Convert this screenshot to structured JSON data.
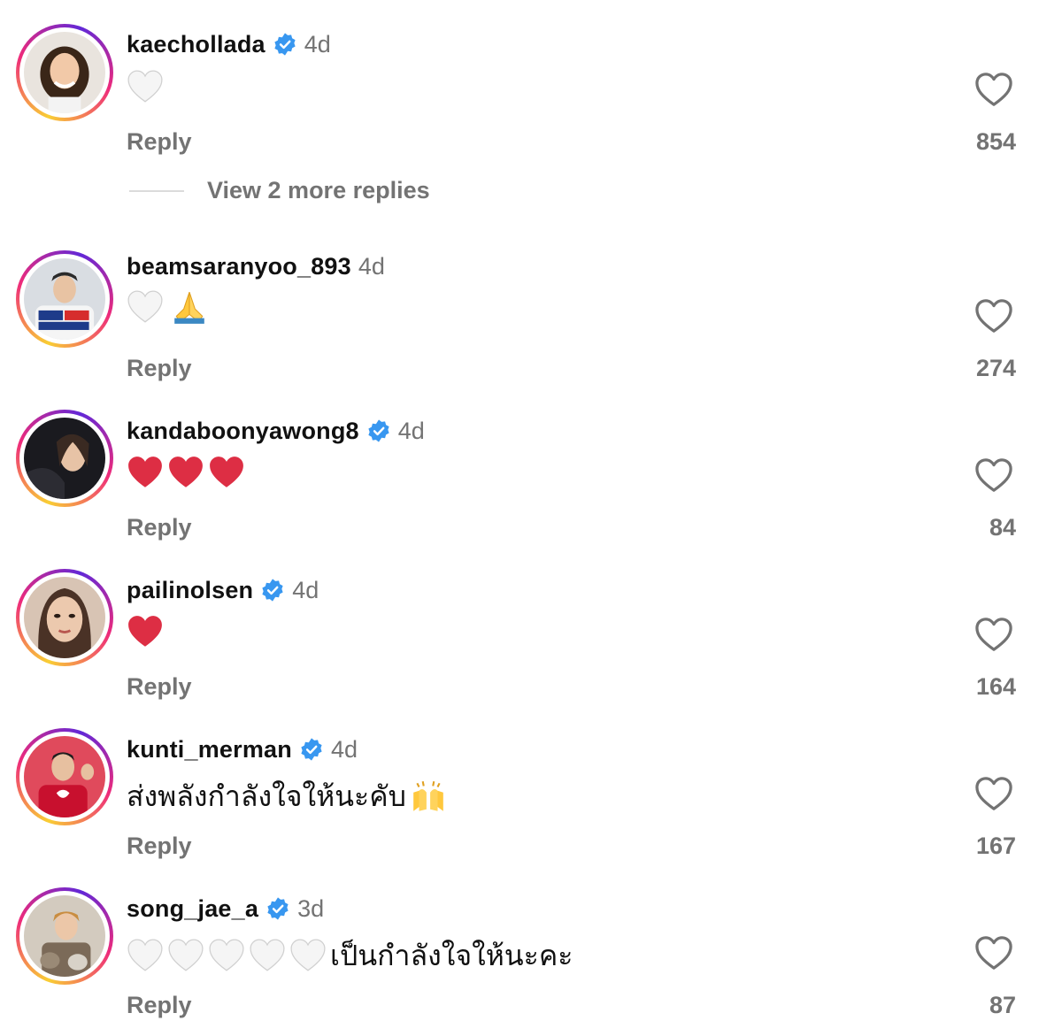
{
  "comments": [
    {
      "username": "kaechollada",
      "verified": true,
      "time": "4d",
      "emojis": [
        "white-heart"
      ],
      "text": "",
      "reply": "Reply",
      "likes": "854"
    },
    {
      "username": "beamsaranyoo_893",
      "verified": false,
      "time": "4d",
      "emojis": [
        "white-heart",
        "folded-hands"
      ],
      "text": "",
      "reply": "Reply",
      "likes": "274"
    },
    {
      "username": "kandaboonyawong8",
      "verified": true,
      "time": "4d",
      "emojis": [
        "red-heart",
        "red-heart",
        "red-heart"
      ],
      "text": "",
      "reply": "Reply",
      "likes": "84"
    },
    {
      "username": "pailinolsen",
      "verified": true,
      "time": "4d",
      "emojis": [
        "red-heart"
      ],
      "text": "",
      "reply": "Reply",
      "likes": "164"
    },
    {
      "username": "kunti_merman",
      "verified": true,
      "time": "4d",
      "emojis": [],
      "text": "ส่งพลังกำลังใจให้นะคับ",
      "reply": "Reply",
      "likes": "167"
    },
    {
      "username": "song_jae_a",
      "verified": true,
      "time": "3d",
      "emojis": [
        "white-heart",
        "white-heart",
        "white-heart",
        "white-heart",
        "white-heart"
      ],
      "text": "เป็นกำลังใจให้นะคะ",
      "reply": "Reply",
      "likes": "87"
    }
  ],
  "view_replies": "View 2 more replies",
  "colors": {
    "verified": "#3897f0",
    "muted": "#737373",
    "red_heart": "#dd2e44"
  }
}
